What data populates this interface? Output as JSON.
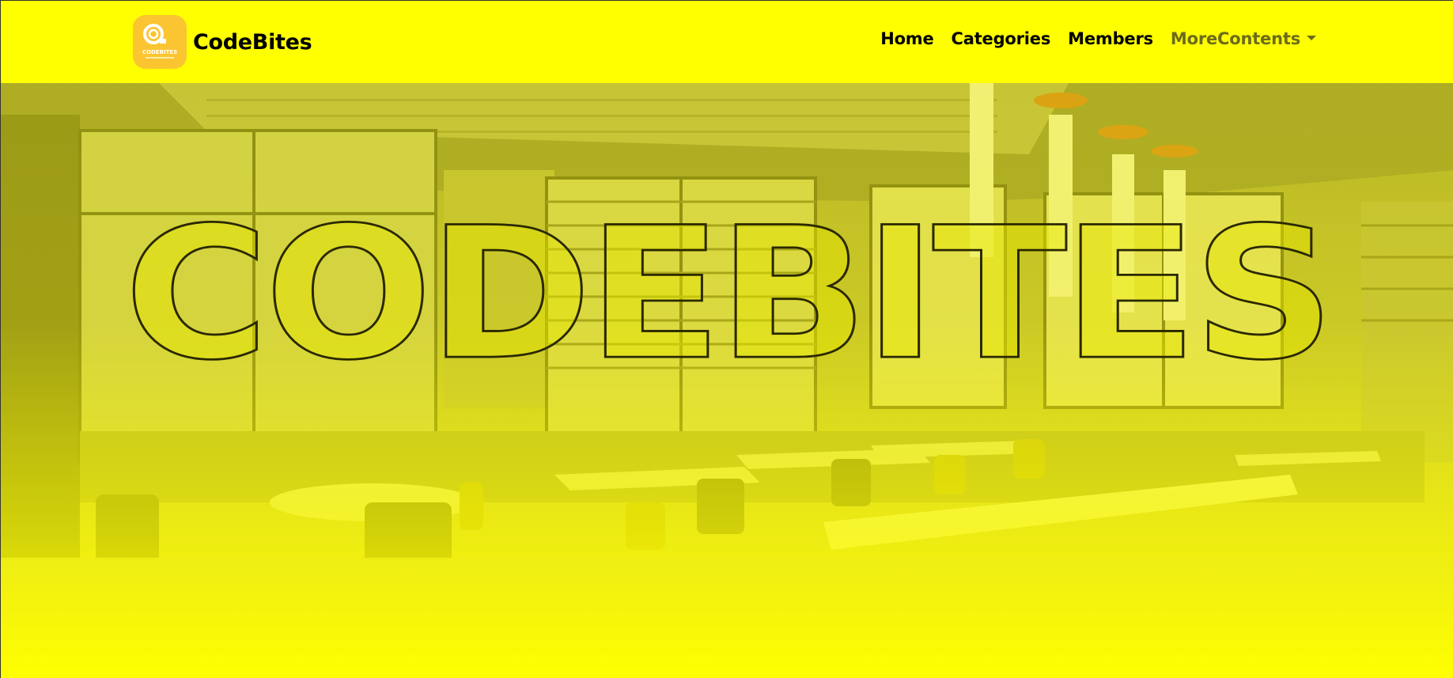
{
  "navbar": {
    "brand": {
      "name": "CodeBites",
      "logo_text": "CODEBITES"
    },
    "links": [
      {
        "label": "Home"
      },
      {
        "label": "Categories"
      },
      {
        "label": "Members"
      },
      {
        "label": "MoreContents",
        "dropdown": true
      }
    ]
  },
  "hero": {
    "title": "CODEBITES",
    "background": "restaurant-interior-photo"
  },
  "colors": {
    "navbar_bg": "#ffff00",
    "logo_bg": "#fbc531",
    "text": "#000000",
    "muted_link": "#6b6b1a"
  }
}
